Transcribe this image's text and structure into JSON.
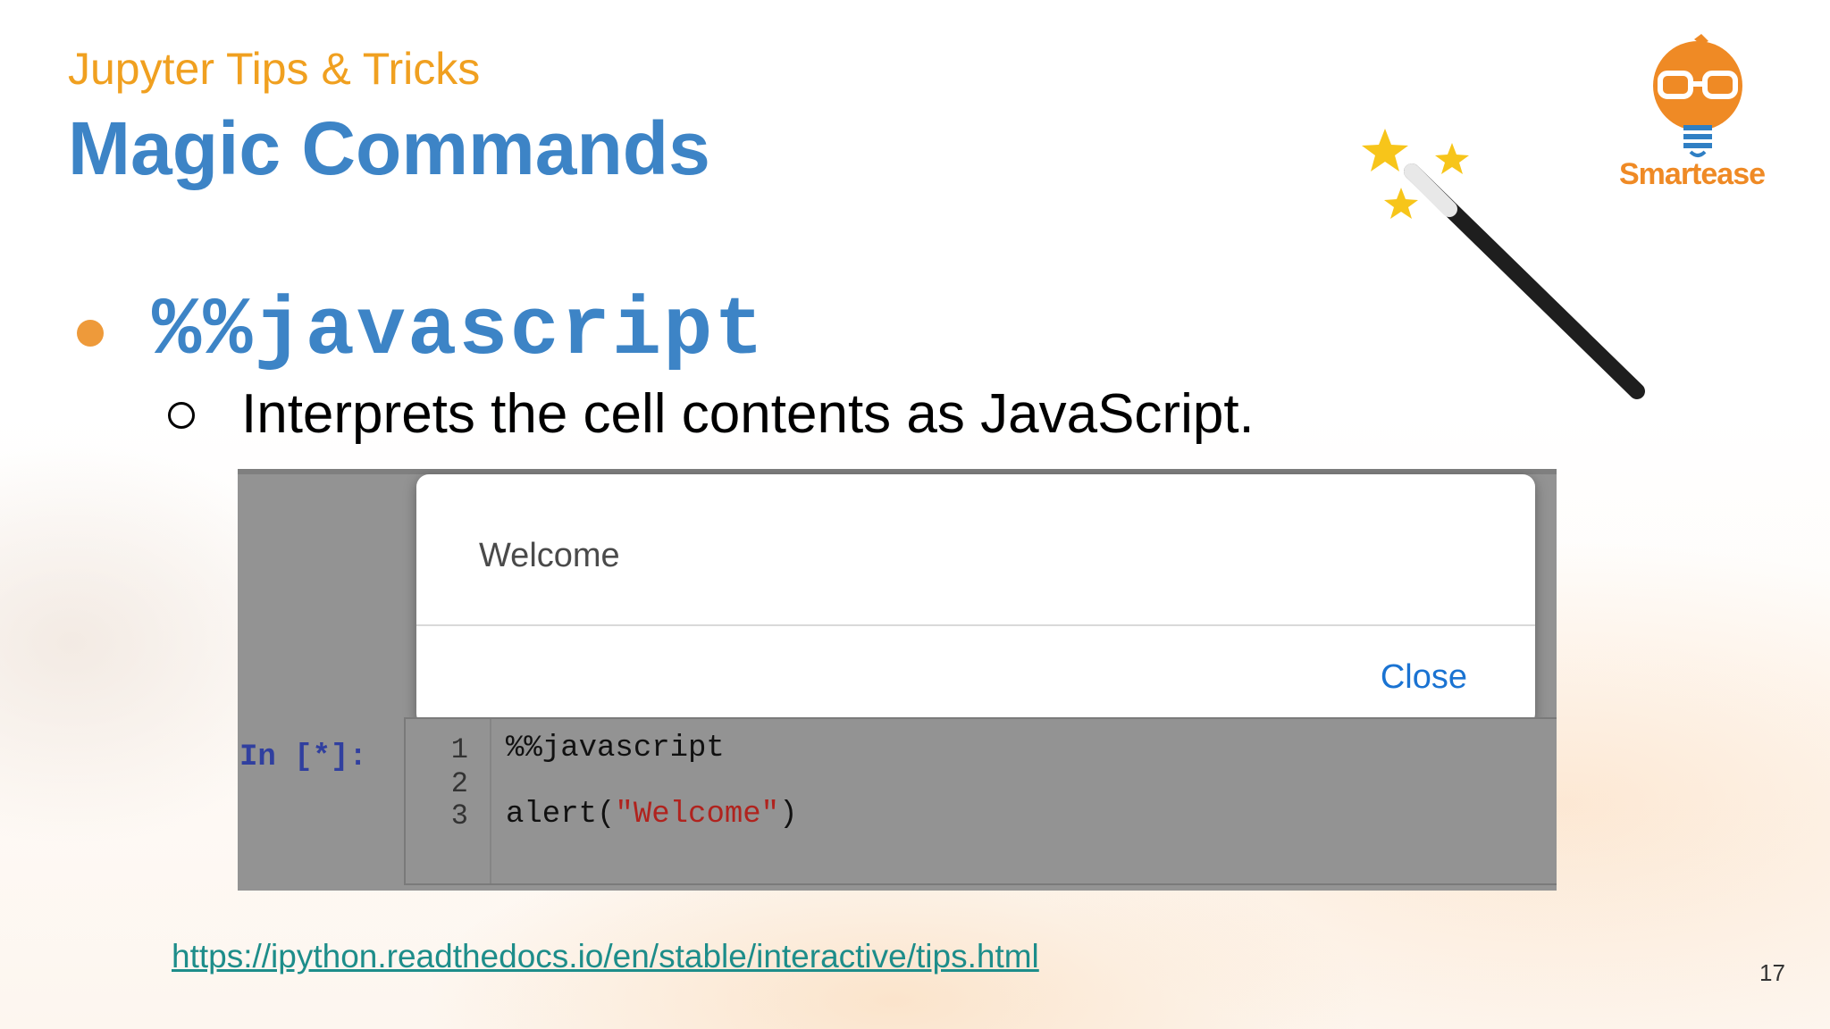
{
  "slide": {
    "subtitle": "Jupyter Tips & Tricks",
    "title": "Magic Commands",
    "bullet": "%%javascript",
    "sub_bullet": "Interprets the cell contents as JavaScript.",
    "link": "https://ipython.readthedocs.io/en/stable/interactive/tips.html",
    "page_number": "17",
    "logo_text": "Smartease"
  },
  "alert": {
    "message": "Welcome",
    "close_label": "Close"
  },
  "cell": {
    "prompt": "In [*]:",
    "line_numbers": [
      "1",
      "2",
      "3"
    ],
    "line1": "%%javascript",
    "line3_prefix": "alert(",
    "line3_string": "\"Welcome\"",
    "line3_suffix": ")"
  },
  "colors": {
    "title_blue": "#3d84c6",
    "subtitle_orange": "#f0a020",
    "bullet_orange": "#ee9a3a",
    "link_teal": "#1d8d8a",
    "close_blue": "#1a73d2"
  }
}
